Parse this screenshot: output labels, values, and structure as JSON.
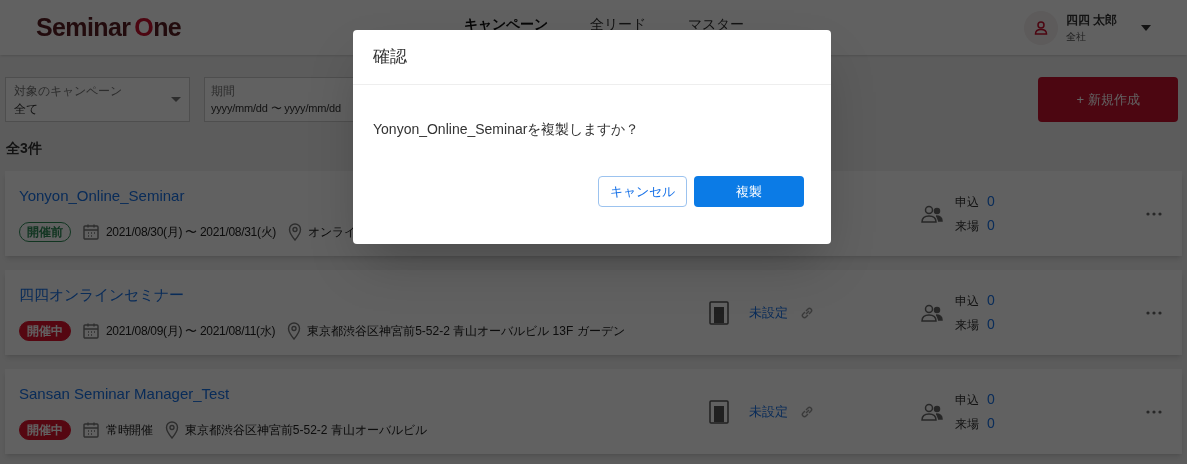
{
  "header": {
    "logo": {
      "main": "Seminar",
      "accent": "O",
      "rest": "ne"
    },
    "nav": [
      {
        "label": "キャンペーン",
        "selected": true
      },
      {
        "label": "全リード",
        "selected": false
      },
      {
        "label": "マスター",
        "selected": false
      }
    ],
    "user": {
      "name": "四四 太郎",
      "org": "全社"
    }
  },
  "filters": {
    "campaign": {
      "label": "対象のキャンペーン",
      "value": "全て"
    },
    "period": {
      "label": "期間",
      "placeholder": "yyyy/mm/dd 〜 yyyy/mm/dd"
    },
    "new_button": "+ 新規作成"
  },
  "count": "全3件",
  "campaigns": [
    {
      "title": "Yonyon_Online_Seminar",
      "status": {
        "label": "開催前",
        "kind": "upcoming"
      },
      "date": "2021/08/30(月) 〜 2021/08/31(火)",
      "venue": "オンライ",
      "stats": [
        {
          "label": "申込",
          "value": "0"
        },
        {
          "label": "来場",
          "value": "0"
        }
      ]
    },
    {
      "title": "四四オンラインセミナー",
      "status": {
        "label": "開催中",
        "kind": "ongoing"
      },
      "date": "2021/08/09(月) 〜 2021/08/11(水)",
      "venue": "東京都渋谷区神宮前5-52-2 青山オーバルビル 13F ガーデン",
      "page": "未設定",
      "stats": [
        {
          "label": "申込",
          "value": "0"
        },
        {
          "label": "来場",
          "value": "0"
        }
      ]
    },
    {
      "title": "Sansan Seminar Manager_Test",
      "status": {
        "label": "開催中",
        "kind": "ongoing"
      },
      "date": "常時開催",
      "venue": "東京都渋谷区神宮前5-52-2 青山オーバルビル",
      "page": "未設定",
      "stats": [
        {
          "label": "申込",
          "value": "0"
        },
        {
          "label": "来場",
          "value": "0"
        }
      ]
    }
  ],
  "dialog": {
    "title": "確認",
    "message": "Yonyon_Online_Seminarを複製しますか？",
    "buttons": [
      {
        "label": "キャンセル",
        "kind": "secondary"
      },
      {
        "label": "複製",
        "kind": "primary"
      }
    ]
  }
}
